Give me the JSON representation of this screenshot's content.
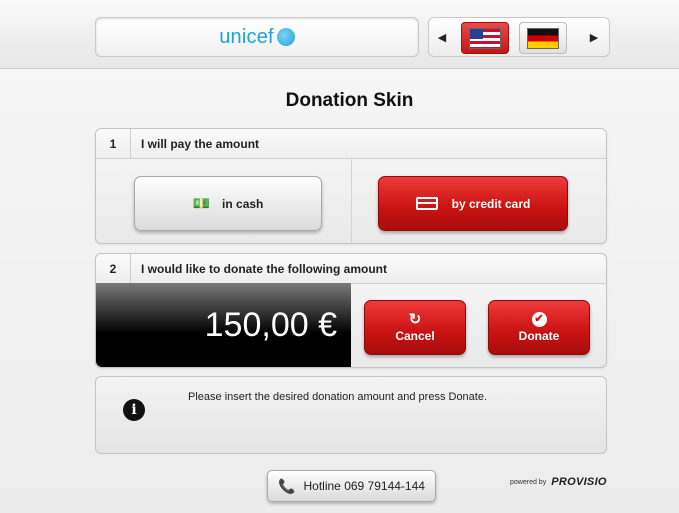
{
  "header": {
    "logo_text": "unicef",
    "lang_prev_icon": "◀",
    "lang_next_icon": "▶",
    "languages": [
      {
        "code": "en-US",
        "icon": "us-flag-icon",
        "selected": true
      },
      {
        "code": "de-DE",
        "icon": "german-flag-icon",
        "selected": false
      }
    ]
  },
  "title": "Donation Skin",
  "step1": {
    "number": "1",
    "label": "I will pay the amount",
    "cash_label": "in cash",
    "card_label": "by credit card"
  },
  "step2": {
    "number": "2",
    "label": "I would like to donate the following amount",
    "amount": "150,00 €",
    "cancel_label": "Cancel",
    "donate_label": "Donate"
  },
  "info": {
    "message": "Please insert the desired donation amount and press Donate."
  },
  "footer": {
    "hotline": "Hotline 069 79144-144",
    "powered_by": "powered by",
    "brand": "PROVISIO"
  },
  "colors": {
    "accent_red": "#cc1414",
    "unicef_blue": "#1ca2dd"
  }
}
